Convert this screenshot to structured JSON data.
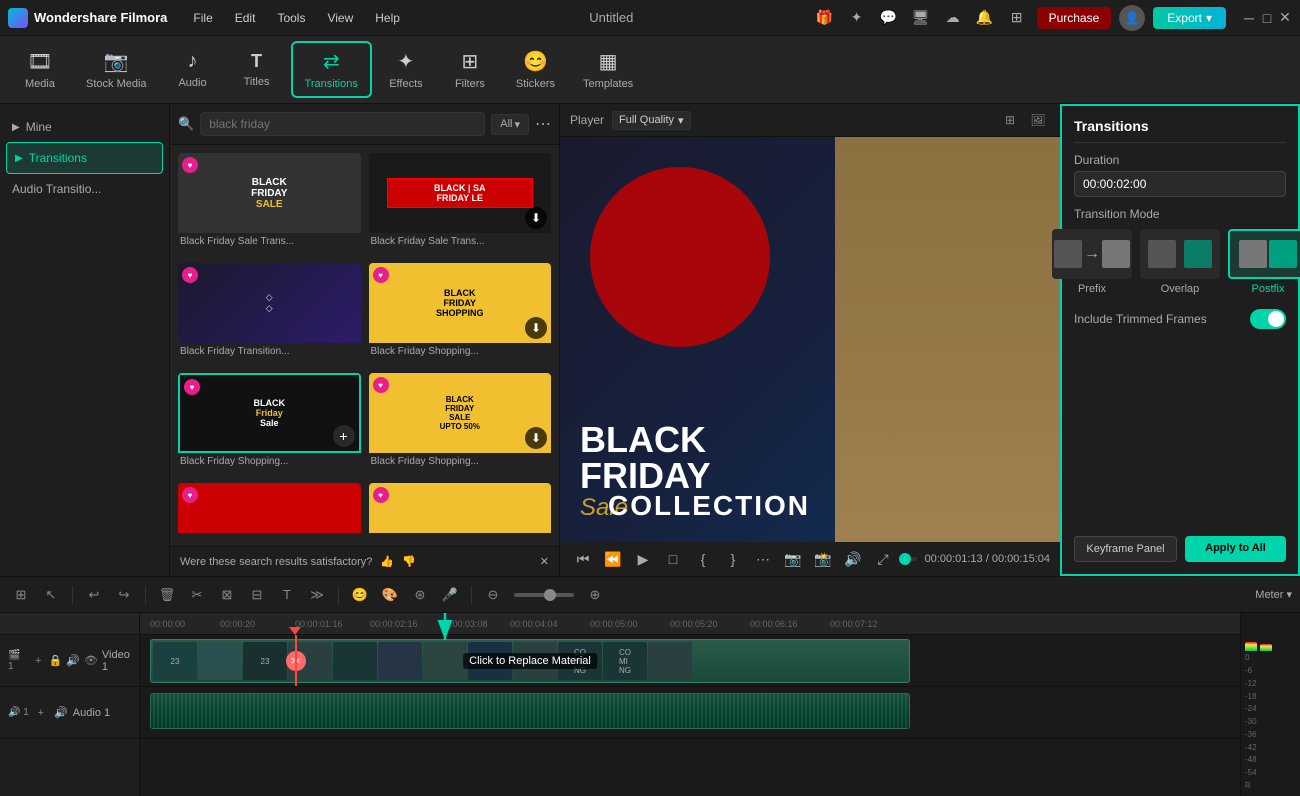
{
  "app": {
    "name": "Wondershare Filmora",
    "title": "Untitled"
  },
  "topbar": {
    "menu": [
      "File",
      "Edit",
      "Tools",
      "View",
      "Help"
    ],
    "purchase_label": "Purchase",
    "export_label": "Export",
    "icons": [
      "gift",
      "star",
      "chat",
      "monitor",
      "cloud",
      "bell",
      "grid",
      "person",
      "more"
    ]
  },
  "toolbar": {
    "items": [
      {
        "id": "media",
        "label": "Media",
        "icon": "🎞"
      },
      {
        "id": "stock",
        "label": "Stock Media",
        "icon": "📷"
      },
      {
        "id": "audio",
        "label": "Audio",
        "icon": "♪"
      },
      {
        "id": "titles",
        "label": "Titles",
        "icon": "T"
      },
      {
        "id": "transitions",
        "label": "Transitions",
        "icon": "↔",
        "active": true
      },
      {
        "id": "effects",
        "label": "Effects",
        "icon": "✦"
      },
      {
        "id": "filters",
        "label": "Filters",
        "icon": "⊞"
      },
      {
        "id": "stickers",
        "label": "Stickers",
        "icon": "😊"
      },
      {
        "id": "templates",
        "label": "Templates",
        "icon": "▦"
      }
    ]
  },
  "sidebar": {
    "items": [
      {
        "id": "mine",
        "label": "Mine"
      },
      {
        "id": "transitions",
        "label": "Transitions",
        "active": true
      },
      {
        "id": "audio_transitions",
        "label": "Audio Transitio..."
      }
    ]
  },
  "search": {
    "placeholder": "black friday",
    "filter_label": "All"
  },
  "grid": {
    "items": [
      {
        "id": 1,
        "label": "Black Friday Sale Trans...",
        "thumb": "thumb-bf1",
        "has_badge": true,
        "downloadable": false
      },
      {
        "id": 2,
        "label": "Black Friday Sale Trans...",
        "thumb": "thumb-bf2",
        "has_badge": false,
        "downloadable": true
      },
      {
        "id": 3,
        "label": "Black Friday Transition...",
        "thumb": "thumb-bf3",
        "has_badge": true,
        "downloadable": false
      },
      {
        "id": 4,
        "label": "Black Friday Shopping...",
        "thumb": "thumb-bf4",
        "has_badge": true,
        "downloadable": true
      },
      {
        "id": 5,
        "label": "Black Friday Shopping...",
        "thumb": "thumb-bf5",
        "has_badge": true,
        "has_add": true,
        "selected": true
      },
      {
        "id": 6,
        "label": "Black Friday Shopping...",
        "thumb": "thumb-bf6",
        "has_badge": true,
        "downloadable": true
      },
      {
        "id": 7,
        "label": "",
        "thumb": "thumb-bf7",
        "partial": true
      },
      {
        "id": 8,
        "label": "",
        "thumb": "thumb-bf8",
        "partial": true
      }
    ]
  },
  "satisfaction": {
    "text": "Were these search results satisfactory?"
  },
  "player": {
    "label": "Player",
    "quality": "Full Quality",
    "current_time": "00:00:01:13",
    "total_time": "00:00:15:04"
  },
  "preview": {
    "title": "BLACK",
    "subtitle_line2": "FRIDAY",
    "sale_text": "Sale",
    "collection_text": "COLLECTION"
  },
  "transitions_panel": {
    "title": "Transitions",
    "duration_label": "Duration",
    "duration_value": "00:00:02:00",
    "mode_label": "Transition Mode",
    "modes": [
      {
        "id": "prefix",
        "label": "Prefix"
      },
      {
        "id": "overlap",
        "label": "Overlap"
      },
      {
        "id": "postfix",
        "label": "Postfix",
        "active": true
      }
    ],
    "include_trimmed": "Include Trimmed Frames",
    "toggle_on": true,
    "keyframe_label": "Keyframe Panel",
    "apply_all_label": "Apply to All"
  },
  "timeline": {
    "toolbar_icons": [
      "grid2",
      "cursor",
      "undo",
      "redo",
      "delete",
      "scissors",
      "crop",
      "split",
      "text",
      "more",
      "face",
      "color",
      "mask",
      "record",
      "zoom_out",
      "zoom_in"
    ],
    "meter_label": "Meter",
    "ruler_times": [
      "00:00:00",
      "00:00:20",
      "00:00:01:16",
      "00:00:02:16",
      "00:00:03:08",
      "00:00:04:04",
      "00:00:05:20",
      "00:00:05:20",
      "00:00:06:16",
      "00:00:07:12"
    ],
    "tracks": [
      {
        "id": "video1",
        "label": "Video 1",
        "num": "1"
      },
      {
        "id": "audio1",
        "label": "Audio 1",
        "num": "1"
      }
    ],
    "clip_label": "Click to Replace Material",
    "meter_values": [
      0,
      -6,
      -12,
      -18,
      -24,
      -30,
      -36,
      -42,
      -48,
      -54
    ]
  },
  "colors": {
    "accent": "#00d4aa",
    "danger": "#ff4444",
    "purchase_bg": "#8b0000",
    "panel_border": "#00d4aa"
  }
}
